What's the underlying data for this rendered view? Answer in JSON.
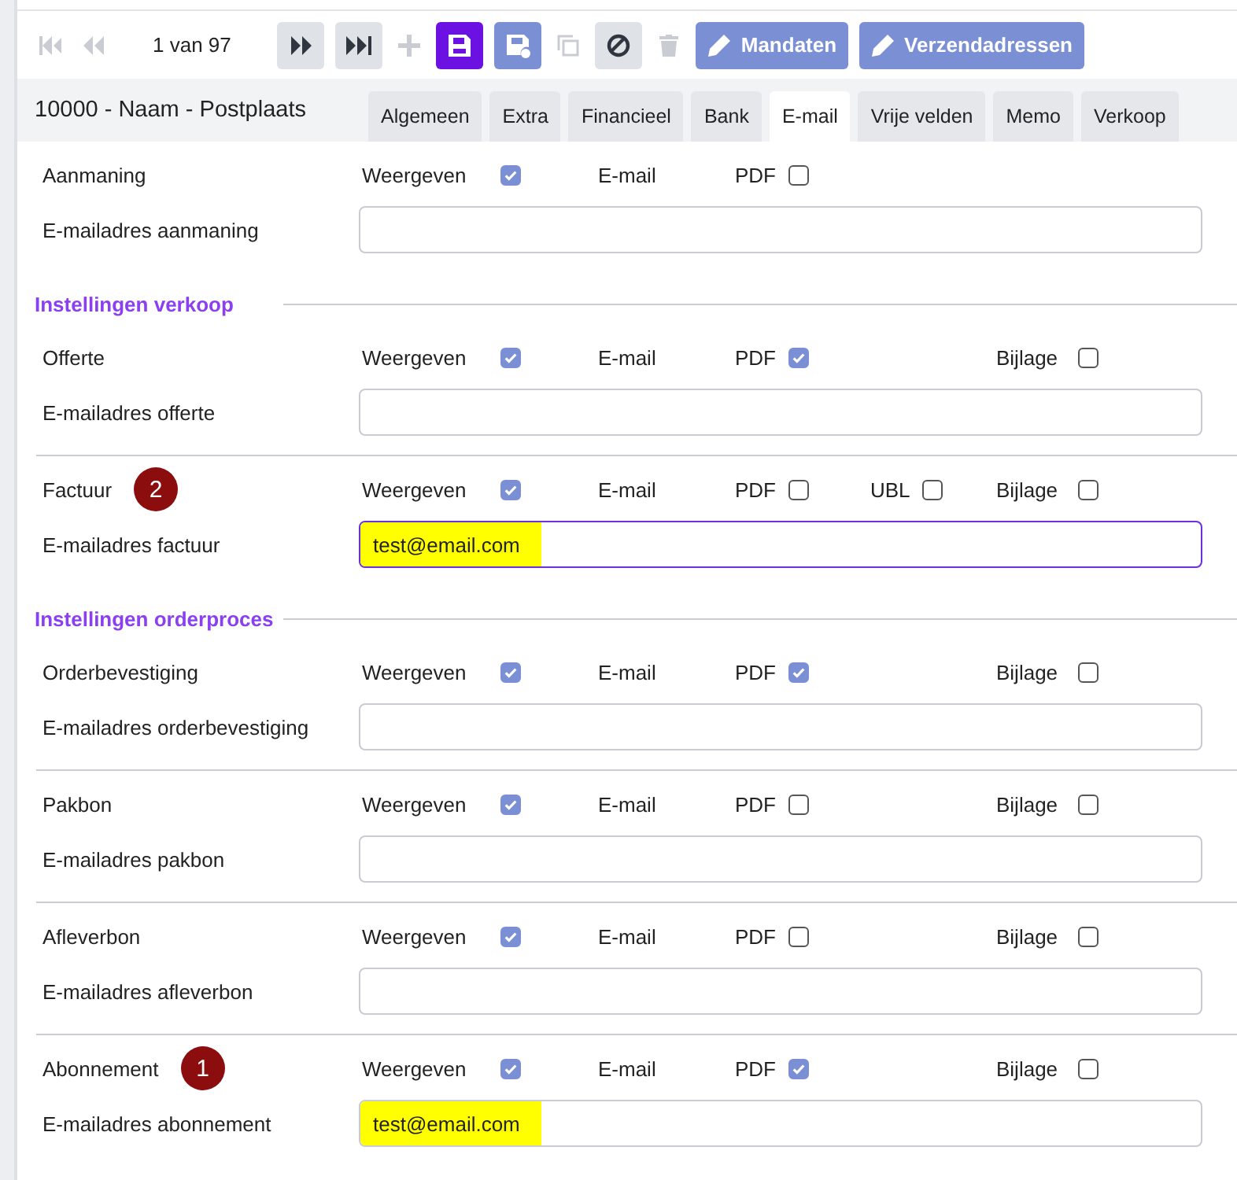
{
  "toolbar": [
    {
      "kind": "first",
      "disabled": true
    },
    {
      "kind": "previous",
      "disabled": true
    },
    {
      "kind": "pager",
      "text": "1 van 97"
    },
    {
      "kind": "next",
      "disabled": false
    },
    {
      "kind": "last",
      "disabled": false
    },
    {
      "kind": "add",
      "disabled": true
    },
    {
      "kind": "save",
      "disabled": false
    },
    {
      "kind": "save-as",
      "disabled": false
    },
    {
      "kind": "copy",
      "disabled": true
    },
    {
      "kind": "cancel",
      "disabled": false
    },
    {
      "kind": "delete",
      "disabled": true
    },
    {
      "kind": "edit",
      "label": "Mandaten",
      "disabled": false
    },
    {
      "kind": "edit",
      "label": "Verzendadressen",
      "disabled": false
    }
  ],
  "header": {
    "title": "10000 - Naam - Postplaats",
    "tabs": [
      {
        "label": "Algemeen",
        "selected": false
      },
      {
        "label": "Extra",
        "selected": false
      },
      {
        "label": "Financieel",
        "selected": false
      },
      {
        "label": "Bank",
        "selected": false
      },
      {
        "label": "E-mail",
        "selected": true
      },
      {
        "label": "Vrije velden",
        "selected": false
      },
      {
        "label": "Memo",
        "selected": false
      },
      {
        "label": "Verkoop",
        "selected": false
      }
    ]
  },
  "sections": [
    {
      "items": [
        {
          "label": "Aanmaning",
          "options": [
            {
              "kind": "display",
              "label": "Weergeven",
              "checked": true
            },
            {
              "kind": "email",
              "label": "E-mail"
            },
            {
              "kind": "pdf",
              "label": "PDF",
              "checked": false
            }
          ],
          "field": {
            "label": "E-mailadres aanmaning",
            "focused": false
          }
        }
      ]
    },
    {
      "heading": "Instellingen verkoop",
      "items": [
        {
          "label": "Offerte",
          "options": [
            {
              "kind": "display",
              "label": "Weergeven",
              "checked": true
            },
            {
              "kind": "email",
              "label": "E-mail"
            },
            {
              "kind": "pdf",
              "label": "PDF",
              "checked": true
            },
            {
              "kind": "attachment",
              "label": "Bijlage",
              "checked": false
            }
          ],
          "field": {
            "label": "E-mailadres offerte",
            "focused": false
          }
        },
        {
          "label": "Factuur",
          "badge": "2",
          "options": [
            {
              "kind": "display",
              "label": "Weergeven",
              "checked": true
            },
            {
              "kind": "email",
              "label": "E-mail"
            },
            {
              "kind": "pdf",
              "label": "PDF",
              "checked": false
            },
            {
              "kind": "ubl",
              "label": "UBL",
              "checked": false
            },
            {
              "kind": "attachment",
              "label": "Bijlage",
              "checked": false
            }
          ],
          "field": {
            "label": "E-mailadres factuur",
            "value": "test@email.com",
            "highlighted": true,
            "focused": true
          }
        }
      ]
    },
    {
      "heading": "Instellingen orderproces",
      "items": [
        {
          "label": "Orderbevestiging",
          "options": [
            {
              "kind": "display",
              "label": "Weergeven",
              "checked": true
            },
            {
              "kind": "email",
              "label": "E-mail"
            },
            {
              "kind": "pdf",
              "label": "PDF",
              "checked": true
            },
            {
              "kind": "attachment",
              "label": "Bijlage",
              "checked": false
            }
          ],
          "field": {
            "label": "E-mailadres orderbevestiging",
            "focused": false
          }
        },
        {
          "label": "Pakbon",
          "options": [
            {
              "kind": "display",
              "label": "Weergeven",
              "checked": true
            },
            {
              "kind": "email",
              "label": "E-mail"
            },
            {
              "kind": "pdf",
              "label": "PDF",
              "checked": false
            },
            {
              "kind": "attachment",
              "label": "Bijlage",
              "checked": false
            }
          ],
          "field": {
            "label": "E-mailadres pakbon",
            "focused": false
          }
        },
        {
          "label": "Afleverbon",
          "options": [
            {
              "kind": "display",
              "label": "Weergeven",
              "checked": true
            },
            {
              "kind": "email",
              "label": "E-mail"
            },
            {
              "kind": "pdf",
              "label": "PDF",
              "checked": false
            },
            {
              "kind": "attachment",
              "label": "Bijlage",
              "checked": false
            }
          ],
          "field": {
            "label": "E-mailadres afleverbon",
            "focused": false
          }
        },
        {
          "label": "Abonnement",
          "badge": "1",
          "options": [
            {
              "kind": "display",
              "label": "Weergeven",
              "checked": true
            },
            {
              "kind": "email",
              "label": "E-mail"
            },
            {
              "kind": "pdf",
              "label": "PDF",
              "checked": true
            },
            {
              "kind": "attachment",
              "label": "Bijlage",
              "checked": false
            }
          ],
          "field": {
            "label": "E-mailadres abonnement",
            "value": "test@email.com",
            "highlighted": true,
            "focused": false
          }
        }
      ]
    }
  ]
}
